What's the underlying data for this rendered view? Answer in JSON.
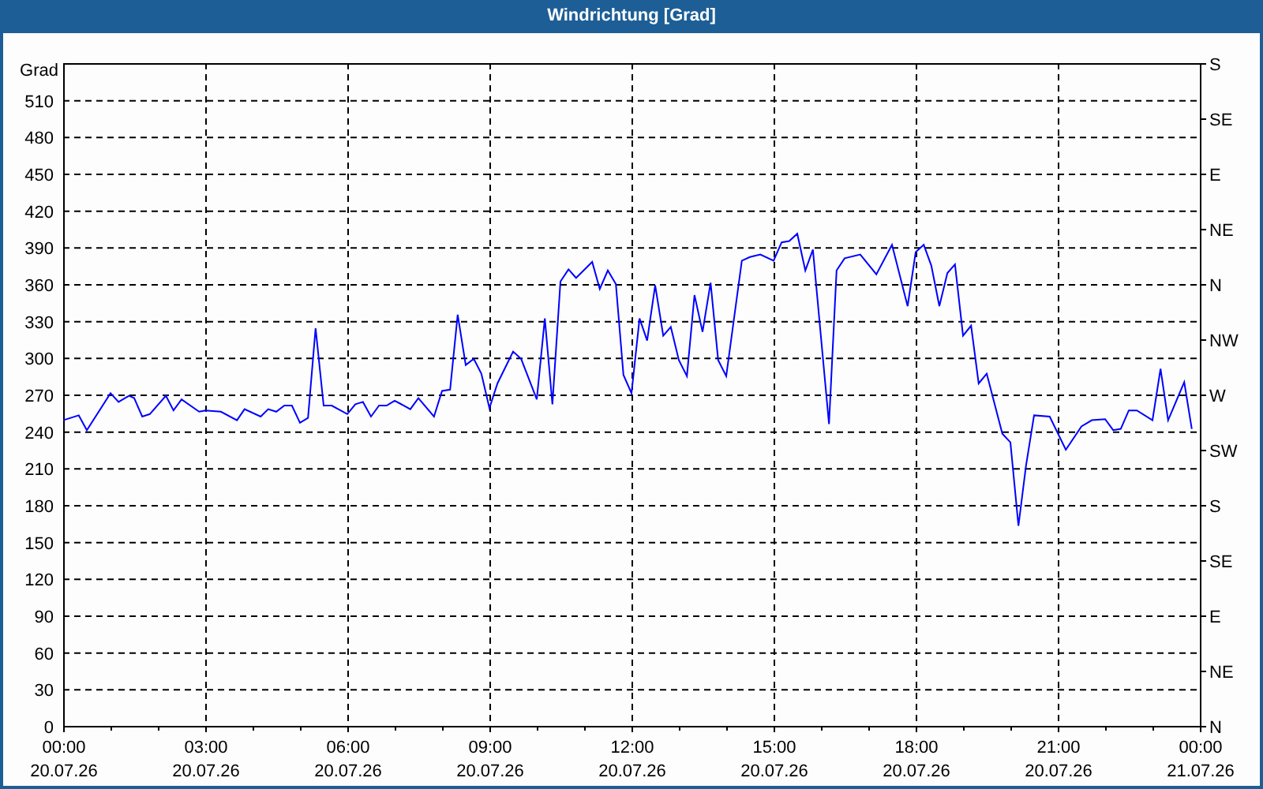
{
  "window": {
    "title": "Windrichtung [Grad]"
  },
  "chart": {
    "x_dates": [
      "20.07.26",
      "20.07.26",
      "20.07.26",
      "20.07.26",
      "20.07.26",
      "20.07.26",
      "20.07.26",
      "20.07.26",
      "21.07.26"
    ],
    "compass_labels": [
      "S",
      "SE",
      "E",
      "NE",
      "N",
      "NW",
      "W",
      "SW",
      "S",
      "SE",
      "E",
      "NE",
      "N"
    ],
    "chart_data": {
      "type": "line",
      "ylabel": "Grad",
      "x": [
        0,
        0.33,
        0.5,
        1,
        1.17,
        1.39,
        1.5,
        1.67,
        1.83,
        2.17,
        2.33,
        2.5,
        2.87,
        3,
        3.33,
        3.67,
        3.83,
        4.17,
        4.33,
        4.5,
        4.67,
        4.83,
        5,
        5.17,
        5.33,
        5.5,
        5.67,
        6,
        6.17,
        6.33,
        6.5,
        6.67,
        6.83,
        7,
        7.33,
        7.5,
        7.83,
        8,
        8.17,
        8.33,
        8.5,
        8.67,
        8.83,
        9,
        9.17,
        9.5,
        9.67,
        10,
        10.17,
        10.33,
        10.5,
        10.67,
        10.83,
        11.17,
        11.33,
        11.5,
        11.67,
        11.83,
        12,
        12.17,
        12.33,
        12.5,
        12.67,
        12.83,
        13,
        13.17,
        13.33,
        13.5,
        13.67,
        13.83,
        14,
        14.33,
        14.5,
        14.72,
        15,
        15.17,
        15.33,
        15.5,
        15.67,
        15.83,
        16.17,
        16.33,
        16.5,
        16.83,
        17.17,
        17.5,
        17.83,
        18,
        18.17,
        18.33,
        18.5,
        18.67,
        18.83,
        19,
        19.17,
        19.33,
        19.5,
        19.83,
        20,
        20.17,
        20.33,
        20.5,
        20.83,
        21.17,
        21.5,
        21.72,
        22,
        22.17,
        22.33,
        22.5,
        22.67,
        23,
        23.17,
        23.33,
        23.67,
        23.83
      ],
      "series": [
        {
          "color": "#0000ff",
          "values": [
            249,
            253,
            241,
            271,
            264,
            269,
            267,
            252,
            254,
            269,
            257,
            266,
            256,
            257,
            256,
            249,
            258,
            252,
            258,
            256,
            261,
            261,
            247,
            251,
            324,
            261,
            261,
            254,
            262,
            264,
            252,
            261,
            261,
            265,
            258,
            267,
            252,
            273,
            274,
            335,
            294,
            299,
            287,
            259,
            279,
            305,
            299,
            266,
            332,
            262,
            362,
            372,
            365,
            378,
            356,
            371,
            360,
            286,
            271,
            332,
            314,
            359,
            318,
            325,
            298,
            285,
            351,
            321,
            361,
            298,
            285,
            379,
            382,
            384,
            379,
            394,
            395,
            401,
            371,
            388,
            246,
            371,
            381,
            384,
            368,
            392,
            342,
            386,
            392,
            375,
            342,
            369,
            376,
            318,
            326,
            279,
            287,
            238,
            231,
            163,
            212,
            253,
            252,
            225,
            244,
            249,
            250,
            241,
            242,
            257,
            257,
            249,
            291,
            249,
            280,
            242
          ]
        }
      ],
      "xlim": [
        0,
        24
      ],
      "ylim": [
        0,
        540
      ],
      "xticks": [
        {
          "value": 0,
          "label": "00:00"
        },
        {
          "value": 3,
          "label": "03:00"
        },
        {
          "value": 6,
          "label": "06:00"
        },
        {
          "value": 9,
          "label": "09:00"
        },
        {
          "value": 12,
          "label": "12:00"
        },
        {
          "value": 15,
          "label": "15:00"
        },
        {
          "value": 18,
          "label": "18:00"
        },
        {
          "value": 21,
          "label": "21:00"
        },
        {
          "value": 24,
          "label": "00:00"
        }
      ],
      "grid": true,
      "yticks": [
        0,
        30,
        60,
        90,
        120,
        150,
        180,
        210,
        240,
        270,
        300,
        330,
        360,
        390,
        420,
        450,
        480,
        510
      ]
    }
  }
}
